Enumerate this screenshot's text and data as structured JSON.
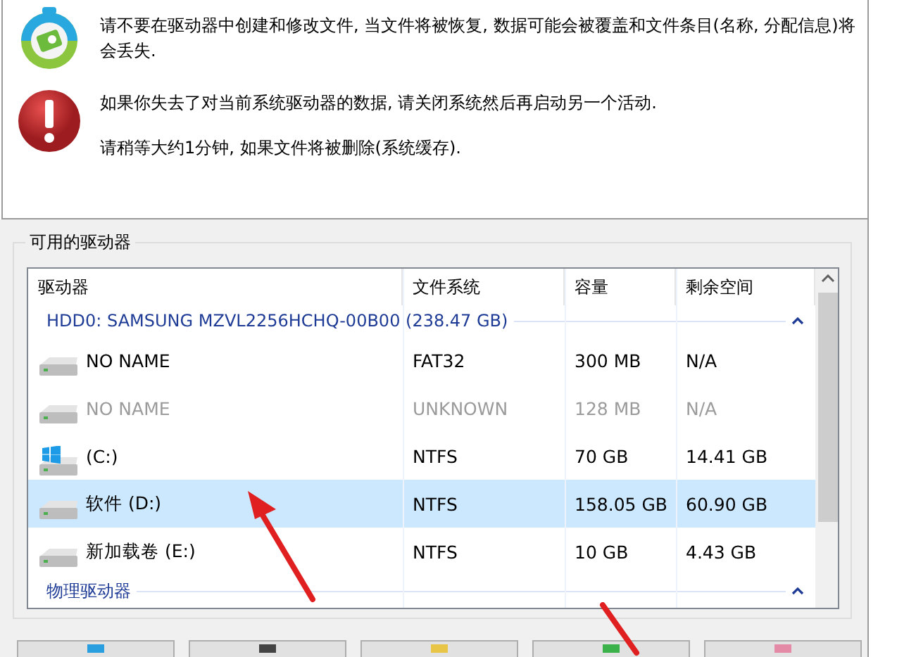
{
  "notices": [
    {
      "kind": "app",
      "paragraphs": [
        "请不要在驱动器中创建和修改文件, 当文件将被恢复, 数据可能会被覆盖和文件条目(名称, 分配信息)将会丢失."
      ]
    },
    {
      "kind": "error",
      "paragraphs": [
        "如果你失去了对当前系统驱动器的数据, 请关闭系统然后再启动另一个活动.",
        "请稍等大约1分钟, 如果文件将被删除(系统缓存)."
      ]
    }
  ],
  "drives_group": {
    "title": "可用的驱动器",
    "columns": [
      "驱动器",
      "文件系统",
      "容量",
      "剩余空间"
    ],
    "groups": [
      {
        "title": "HDD0: SAMSUNG MZVL2256HCHQ-00B00 (238.47 GB)",
        "expanded": true,
        "rows": [
          {
            "kind": "drive",
            "name": "NO NAME",
            "file_system": "FAT32",
            "capacity": "300 MB",
            "free": "N/A",
            "disabled": false,
            "selected": false
          },
          {
            "kind": "drive",
            "name": "NO NAME",
            "file_system": "UNKNOWN",
            "capacity": "128 MB",
            "free": "N/A",
            "disabled": true,
            "selected": false
          },
          {
            "kind": "system",
            "name": "(C:)",
            "file_system": "NTFS",
            "capacity": "70 GB",
            "free": "14.41 GB",
            "disabled": false,
            "selected": false
          },
          {
            "kind": "drive",
            "name": "软件 (D:)",
            "file_system": "NTFS",
            "capacity": "158.05 GB",
            "free": "60.90 GB",
            "disabled": false,
            "selected": true
          },
          {
            "kind": "drive",
            "name": "新加载卷 (E:)",
            "file_system": "NTFS",
            "capacity": "10 GB",
            "free": "4.43 GB",
            "disabled": false,
            "selected": false
          }
        ]
      },
      {
        "title": "物理驱动器",
        "expanded": true
      }
    ]
  },
  "bottom_buttons": [
    {
      "kind": "blue"
    },
    {
      "kind": "dark"
    },
    {
      "kind": "folder"
    },
    {
      "kind": "green"
    },
    {
      "kind": "pink"
    }
  ]
}
